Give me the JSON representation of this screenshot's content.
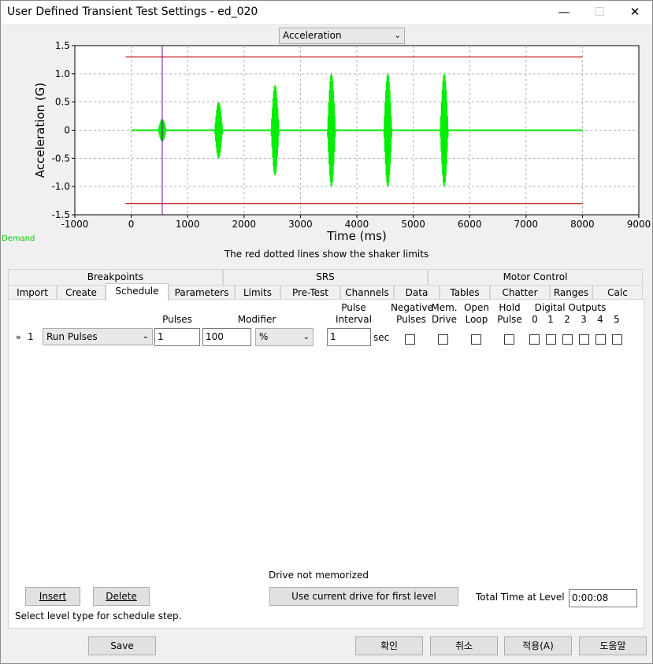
{
  "window": {
    "title": "User Defined Transient Test Settings - ed_020",
    "minimize_icon": "minimize-icon",
    "maximize_icon": "maximize-icon",
    "close_icon": "close-icon"
  },
  "plot_selector": {
    "value": "Acceleration"
  },
  "chart_data": {
    "type": "line",
    "xlabel": "Time (ms)",
    "ylabel": "Acceleration (G)",
    "xlim": [
      -1000,
      9000
    ],
    "ylim": [
      -1.5,
      1.5
    ],
    "x_ticks": [
      "-1000",
      "0",
      "1000",
      "2000",
      "3000",
      "4000",
      "5000",
      "6000",
      "7000",
      "8000",
      "9000"
    ],
    "y_ticks": [
      "1.5",
      "1.0",
      "0.5",
      "0",
      "-0.5",
      "-1.0",
      "-1.5"
    ],
    "grid": true,
    "baseline": {
      "x_start": 0,
      "x_end": 8000,
      "value": 0,
      "color": "#00ee00"
    },
    "pulses": [
      {
        "t": 550,
        "amplitude": 0.2
      },
      {
        "t": 1550,
        "amplitude": 0.5
      },
      {
        "t": 2550,
        "amplitude": 0.8
      },
      {
        "t": 3550,
        "amplitude": 1.0
      },
      {
        "t": 4550,
        "amplitude": 1.0
      },
      {
        "t": 5550,
        "amplitude": 1.0
      }
    ],
    "limits": {
      "upper": 1.3,
      "lower": -1.3,
      "x_start": -100,
      "x_end": 8000,
      "color": "#c00000"
    },
    "cursor": {
      "x": 550,
      "color": "#8000a0"
    },
    "colors": {
      "signal": "#00ee00",
      "limit": "#c00000",
      "cursor": "#8000a0",
      "grid": "#b0b0b0"
    }
  },
  "chart_caption": "The red dotted lines show the shaker limits",
  "demand_label": "Demand",
  "tabs_row1": [
    "Breakpoints",
    "SRS",
    "Motor Control"
  ],
  "tabs_row2": [
    "Import",
    "Create",
    "Schedule",
    "Parameters",
    "Limits",
    "Pre-Test",
    "Channels",
    "Data",
    "Tables",
    "Chatter",
    "Ranges",
    "Calc"
  ],
  "active_tab": "Schedule",
  "schedule": {
    "headers": {
      "pulses": "Pulses",
      "modifier": "Modifier",
      "pulse_interval_1": "Pulse",
      "pulse_interval_2": "Interval",
      "negative_1": "Negative",
      "negative_2": "Pulses",
      "mem_1": "Mem.",
      "mem_2": "Drive",
      "open_1": "Open",
      "open_2": "Loop",
      "hold_1": "Hold",
      "hold_2": "Pulse",
      "digital_outputs": "Digital Outputs",
      "digital_channels": [
        "0",
        "1",
        "2",
        "3",
        "4",
        "5"
      ]
    },
    "row": {
      "marker": "»",
      "index": "1",
      "type": "Run Pulses",
      "pulses": "1",
      "modifier_value": "100",
      "modifier_unit": "%",
      "interval": "1",
      "interval_unit": "sec"
    }
  },
  "drive_status": "Drive not memorized",
  "use_current_drive_label": "Use current drive for first level",
  "total_time_label": "Total Time at Level",
  "total_time_value": "0:00:08",
  "insert_label": "Insert",
  "delete_label": "Delete",
  "hint_text": "Select level type for schedule step.",
  "footer": {
    "save": "Save",
    "ok": "확인",
    "cancel": "취소",
    "apply": "적용(A)",
    "help": "도움말"
  }
}
